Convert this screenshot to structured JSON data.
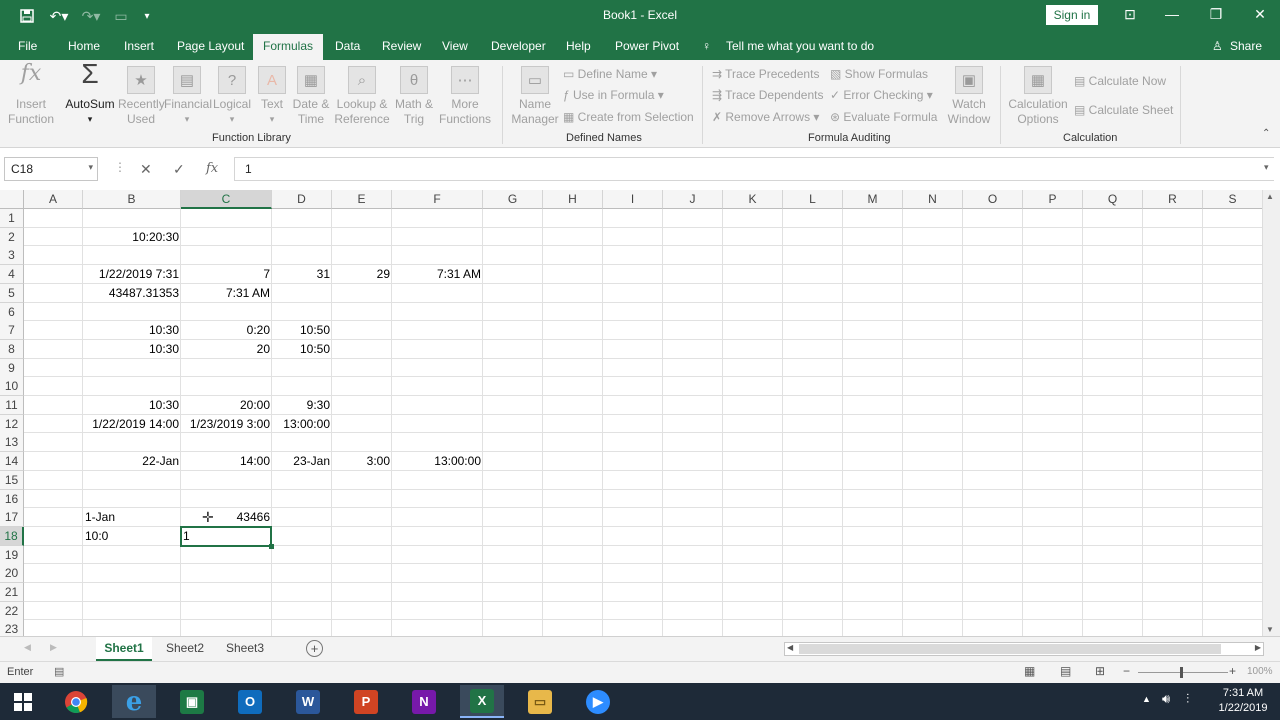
{
  "window": {
    "title": "Book1 - Excel",
    "sign_in": "Sign in"
  },
  "menu": {
    "tabs": [
      "File",
      "Home",
      "Insert",
      "Page Layout",
      "Formulas",
      "Data",
      "Review",
      "View",
      "Developer",
      "Help",
      "Power Pivot"
    ],
    "active_tab": "Formulas",
    "tell_me": "Tell me what you want to do",
    "share": "Share"
  },
  "ribbon": {
    "insert_function": "Insert\nFunction",
    "autosum": "AutoSum",
    "recently_used": "Recently\nUsed",
    "financial": "Financial",
    "logical": "Logical",
    "text": "Text",
    "date_time": "Date &\nTime",
    "lookup_reference": "Lookup &\nReference",
    "math_trig": "Math &\nTrig",
    "more_functions": "More\nFunctions",
    "group_function_library": "Function Library",
    "name_manager": "Name\nManager",
    "define_name": "Define Name",
    "use_in_formula": "Use in Formula",
    "create_from_selection": "Create from Selection",
    "group_defined_names": "Defined Names",
    "trace_precedents": "Trace Precedents",
    "trace_dependents": "Trace Dependents",
    "remove_arrows": "Remove Arrows",
    "show_formulas": "Show Formulas",
    "error_checking": "Error Checking",
    "evaluate_formula": "Evaluate Formula",
    "watch_window": "Watch\nWindow",
    "group_formula_auditing": "Formula Auditing",
    "calculation_options": "Calculation\nOptions",
    "calculate_now": "Calculate Now",
    "calculate_sheet": "Calculate Sheet",
    "group_calculation": "Calculation"
  },
  "formula_bar": {
    "name_box": "C18",
    "fx": "fx",
    "content": "1"
  },
  "grid": {
    "columns": [
      "A",
      "B",
      "C",
      "D",
      "E",
      "F",
      "G",
      "H",
      "I",
      "J",
      "K",
      "L",
      "M",
      "N",
      "O",
      "P",
      "Q",
      "R",
      "S"
    ],
    "rows": [
      "1",
      "2",
      "3",
      "4",
      "5",
      "6",
      "7",
      "8",
      "9",
      "10",
      "11",
      "12",
      "13",
      "14",
      "15",
      "16",
      "17",
      "18",
      "19",
      "20",
      "21",
      "22",
      "23"
    ],
    "selected_column": "C",
    "selected_row": "18",
    "cells": {
      "B2": "10:20:30",
      "B4": "1/22/2019 7:31",
      "C4": "7",
      "D4": "31",
      "E4": "29",
      "F4": "7:31 AM",
      "B5": "43487.31353",
      "C5": "7:31 AM",
      "B7": "10:30",
      "C7": "0:20",
      "D7": "10:50",
      "B8": "10:30",
      "C8": "20",
      "D8": "10:50",
      "B11": "10:30",
      "C11": "20:00",
      "D11": "9:30",
      "B12": "1/22/2019 14:00",
      "C12": "1/23/2019 3:00",
      "D12": "13:00:00",
      "B14": "22-Jan",
      "C14": "14:00",
      "D14": "23-Jan",
      "E14": "3:00",
      "F14": "13:00:00",
      "B17": "1-Jan",
      "C17": "43466",
      "B18": "10:0",
      "C18": "1"
    }
  },
  "sheets": [
    "Sheet1",
    "Sheet2",
    "Sheet3"
  ],
  "active_sheet": "Sheet1",
  "status": {
    "mode": "Enter",
    "zoom": "100%"
  },
  "taskbar": {
    "time": "7:31 AM",
    "date": "1/22/2019"
  },
  "colors": {
    "excel_green": "#217346",
    "taskbar": "#1e2a38"
  }
}
